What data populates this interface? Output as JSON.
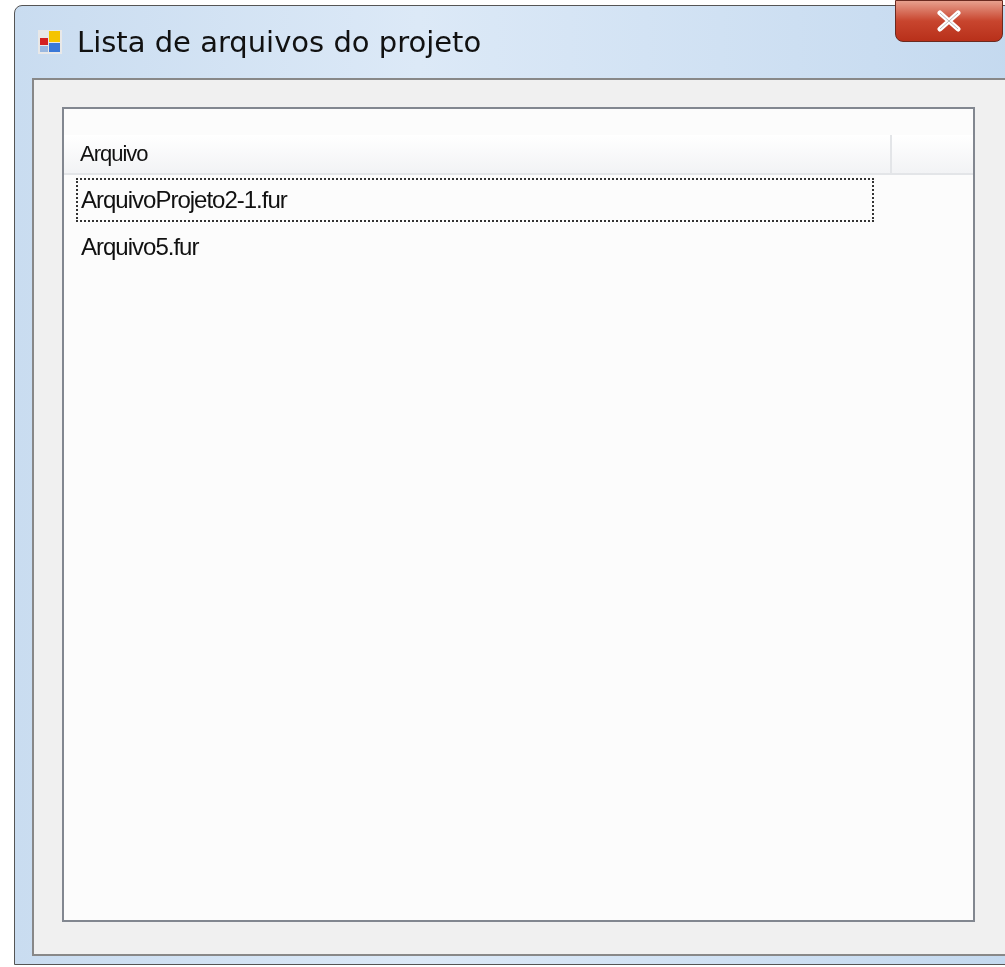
{
  "window": {
    "title": "Lista de arquivos do projeto"
  },
  "list": {
    "columns": [
      "Arquivo"
    ],
    "rows": [
      {
        "name": "ArquivoProjeto2-1.fur",
        "focused": true
      },
      {
        "name": "Arquivo5.fur",
        "focused": false
      }
    ]
  }
}
